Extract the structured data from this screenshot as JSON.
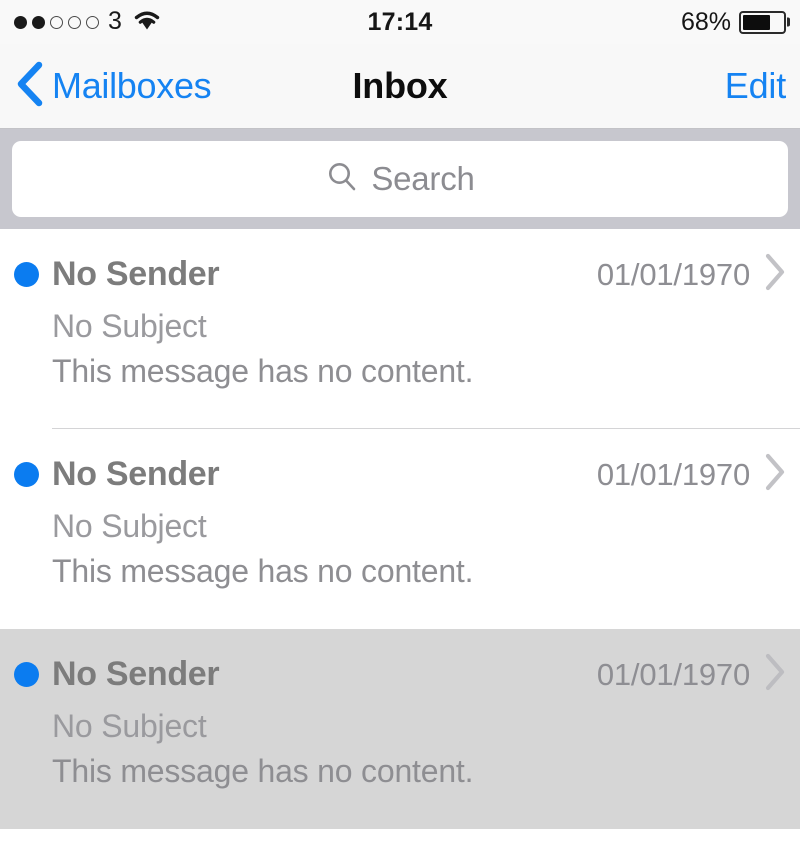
{
  "status_bar": {
    "signal_dots_filled": 2,
    "signal_dots_total": 5,
    "carrier": "3",
    "wifi_icon": "wifi-icon",
    "time": "17:14",
    "battery_percent": "68%",
    "battery_level": 68
  },
  "nav_bar": {
    "back_icon": "chevron-left-icon",
    "back_label": "Mailboxes",
    "title": "Inbox",
    "edit_label": "Edit",
    "accent_color": "#1583f2"
  },
  "search": {
    "icon": "search-icon",
    "placeholder": "Search",
    "value": ""
  },
  "mail_list": {
    "unread_dot_color": "#0b7cf0",
    "selected_row_color": "#d6d6d6",
    "disclosure_icon": "chevron-right-icon",
    "rows": [
      {
        "sender": "No Sender",
        "date": "01/01/1970",
        "subject": "No Subject",
        "preview": "This message has no content.",
        "unread": true,
        "selected": false
      },
      {
        "sender": "No Sender",
        "date": "01/01/1970",
        "subject": "No Subject",
        "preview": "This message has no content.",
        "unread": true,
        "selected": false
      },
      {
        "sender": "No Sender",
        "date": "01/01/1970",
        "subject": "No Subject",
        "preview": "This message has no content.",
        "unread": true,
        "selected": true
      }
    ]
  }
}
